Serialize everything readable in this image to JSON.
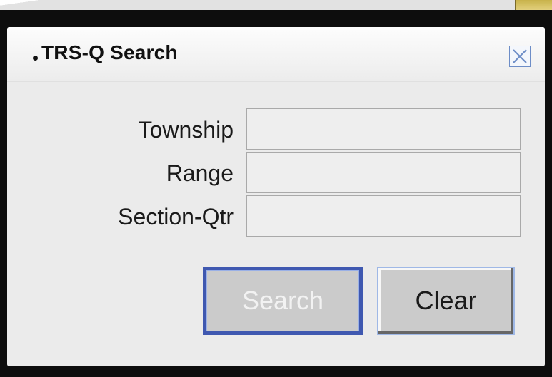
{
  "dialog": {
    "title": "TRS-Q Search",
    "close_icon": "close-icon"
  },
  "form": {
    "fields": [
      {
        "label": "Township",
        "value": ""
      },
      {
        "label": "Range",
        "value": ""
      },
      {
        "label": "Section-Qtr",
        "value": ""
      }
    ]
  },
  "buttons": {
    "search_label": "Search",
    "clear_label": "Clear"
  },
  "colors": {
    "frame": "#0d0d0d",
    "dialog_bg": "#ebebeb",
    "focus_border": "#3f58b0",
    "close_border": "#6d8dc7"
  }
}
